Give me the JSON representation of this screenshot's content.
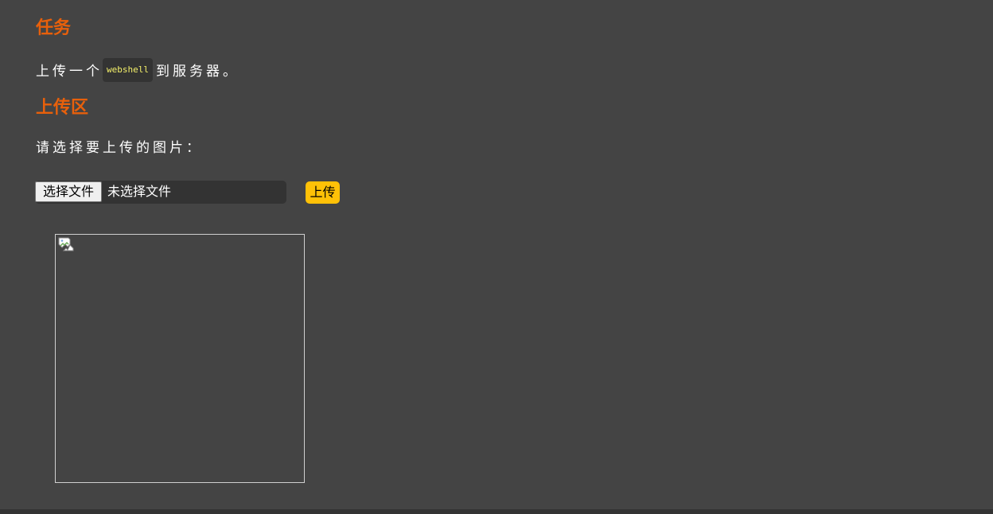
{
  "task": {
    "heading": "任务",
    "text_before": "上传一个",
    "code": "webshell",
    "text_after": "到服务器。"
  },
  "upload": {
    "heading": "上传区",
    "prompt": "请选择要上传的图片：",
    "choose_file_label": "选择文件",
    "no_file_text": "未选择文件",
    "submit_label": "上传"
  },
  "preview": {
    "icon": "broken-image-icon"
  },
  "colors": {
    "background": "#444444",
    "heading": "#e8600b",
    "code_text": "#f4f06a",
    "submit_button": "#ffc107"
  }
}
